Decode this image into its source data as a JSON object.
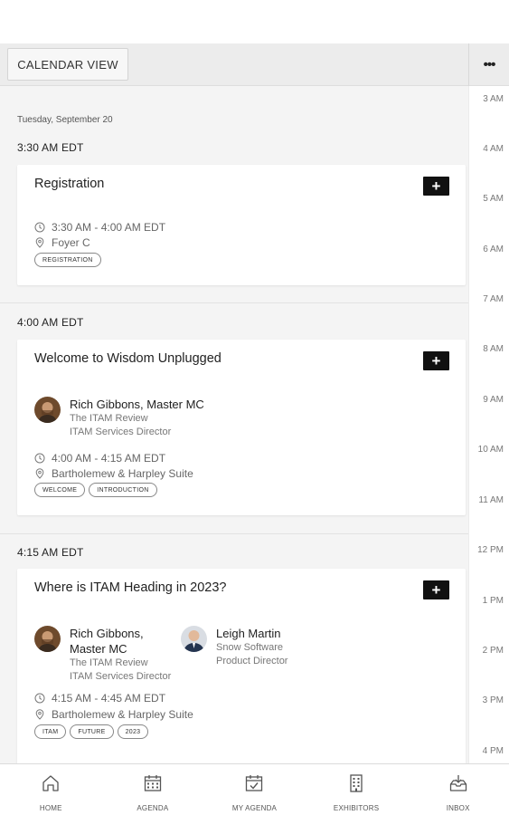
{
  "toolbar": {
    "calendar_view_label": "CALENDAR VIEW",
    "more_label": "•••"
  },
  "date_heading": "Tuesday, September 20",
  "time_rail": [
    "3 AM",
    "4 AM",
    "5 AM",
    "6 AM",
    "7 AM",
    "8 AM",
    "9 AM",
    "10 AM",
    "11 AM",
    "12 PM",
    "1 PM",
    "2 PM",
    "3 PM",
    "4 PM"
  ],
  "slots": [
    {
      "time": "3:30 AM EDT"
    },
    {
      "time": "4:00 AM EDT"
    },
    {
      "time": "4:15 AM EDT"
    }
  ],
  "sessions": [
    {
      "title": "Registration",
      "add_label": "+",
      "time": "3:30 AM - 4:00 AM EDT",
      "location": "Foyer C",
      "tags": [
        "REGISTRATION"
      ]
    },
    {
      "title": "Welcome to Wisdom Unplugged",
      "add_label": "+",
      "speakers": [
        {
          "name": "Rich Gibbons, Master MC",
          "org": "The ITAM Review",
          "role": "ITAM Services Director"
        }
      ],
      "time": "4:00 AM - 4:15 AM EDT",
      "location": "Bartholemew & Harpley Suite",
      "tags": [
        "WELCOME",
        "INTRODUCTION"
      ]
    },
    {
      "title": "Where is ITAM Heading in 2023?",
      "add_label": "+",
      "speakers": [
        {
          "name_line1": "Rich Gibbons,",
          "name_line2": "Master MC",
          "org": "The ITAM Review",
          "role": "ITAM Services Director"
        },
        {
          "name": "Leigh Martin",
          "org": "Snow Software",
          "role": "Product Director"
        }
      ],
      "time": "4:15 AM - 4:45 AM EDT",
      "location": "Bartholemew & Harpley Suite",
      "tags": [
        "ITAM",
        "FUTURE",
        "2023"
      ]
    }
  ],
  "tabs": [
    {
      "label": "HOME",
      "icon": "home-icon"
    },
    {
      "label": "AGENDA",
      "icon": "calendar-icon"
    },
    {
      "label": "MY AGENDA",
      "icon": "calendar-check-icon"
    },
    {
      "label": "EXHIBITORS",
      "icon": "building-icon"
    },
    {
      "label": "INBOX",
      "icon": "inbox-download-icon"
    }
  ]
}
